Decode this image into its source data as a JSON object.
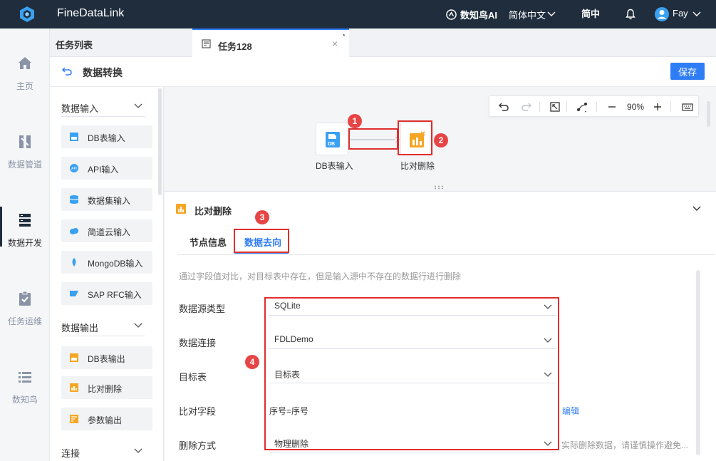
{
  "topbar": {
    "brand": "FineDataLink",
    "ai_label": "数知鸟AI",
    "language": "简体中文",
    "simplified": "简中",
    "user": "Fay"
  },
  "leftnav": {
    "items": [
      {
        "label": "主页",
        "icon": "home-icon"
      },
      {
        "label": "数据管道",
        "icon": "pipeline-icon"
      },
      {
        "label": "数据开发",
        "icon": "server-icon",
        "active": true
      },
      {
        "label": "任务运维",
        "icon": "clipboard-check-icon"
      },
      {
        "label": "数知鸟",
        "icon": "list-icon"
      }
    ]
  },
  "tabs": {
    "task_list": "任务列表",
    "active_tab": "任务128",
    "close": "×",
    "modified": "*"
  },
  "header": {
    "title": "数据转换",
    "save": "保存"
  },
  "operators": {
    "sections": [
      {
        "label": "数据输入"
      },
      {
        "label": "数据输出"
      },
      {
        "label": "连接"
      }
    ],
    "items": [
      {
        "label": "DB表输入",
        "icon": "db-input-icon"
      },
      {
        "label": "API输入",
        "icon": "api-icon"
      },
      {
        "label": "数据集输入",
        "icon": "dataset-icon"
      },
      {
        "label": "简道云输入",
        "icon": "cloud-icon"
      },
      {
        "label": "MongoDB输入",
        "icon": "mongodb-icon"
      },
      {
        "label": "SAP RFC输入",
        "icon": "sap-icon"
      },
      {
        "label": "DB表输出",
        "icon": "db-output-icon"
      },
      {
        "label": "比对删除",
        "icon": "compare-delete-icon"
      },
      {
        "label": "参数输出",
        "icon": "param-output-icon"
      }
    ]
  },
  "canvas": {
    "zoom": "90%",
    "nodes": [
      {
        "label": "DB表输入",
        "badge_text": "DB"
      },
      {
        "label": "比对删除"
      }
    ],
    "badges": [
      "1",
      "2"
    ]
  },
  "detail": {
    "title": "比对删除",
    "tabs": [
      "节点信息",
      "数据去向"
    ],
    "active_tab": "数据去向",
    "badges": [
      "3",
      "4"
    ],
    "description": "通过字段值对比，对目标表中存在，但是输入源中不存在的数据行进行删除",
    "fields": {
      "source_type": {
        "label": "数据源类型",
        "value": "SQLite"
      },
      "connection": {
        "label": "数据连接",
        "value": "FDLDemo"
      },
      "target_table": {
        "label": "目标表",
        "value": "目标表"
      },
      "compare_field": {
        "label": "比对字段",
        "value": "序号=序号",
        "edit": "编辑"
      },
      "delete_mode": {
        "label": "删除方式",
        "value": "物理删除",
        "hint": "实际删除数据，请谨慎操作避免..."
      }
    }
  },
  "colors": {
    "topbar": "#1f2d3d",
    "accent": "#2f7df6",
    "highlight": "#e02d2d",
    "badge": "#e74545",
    "node_orange": "#f5a623"
  }
}
